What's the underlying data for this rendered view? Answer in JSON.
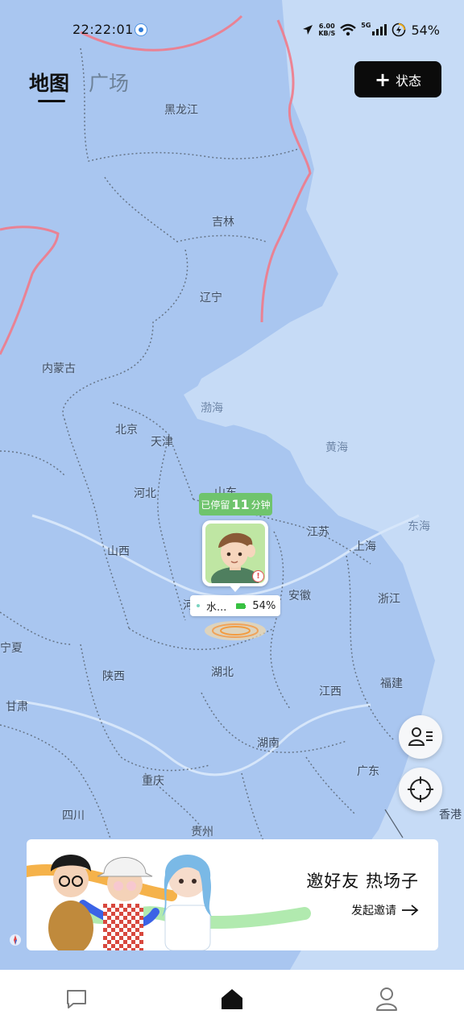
{
  "status_bar": {
    "time": "22:22:01",
    "speed_value": "6.00",
    "speed_unit": "KB/S",
    "network": "5G",
    "battery": "54%"
  },
  "tabs": {
    "map": "地图",
    "plaza": "广场"
  },
  "status_button": {
    "label": "状态",
    "icon": "plus-icon"
  },
  "map": {
    "provinces": [
      "黑龙江",
      "吉林",
      "辽宁",
      "内蒙古",
      "北京",
      "天津",
      "河北",
      "山东",
      "山西",
      "江苏",
      "上海",
      "安徽",
      "河南",
      "浙江",
      "宁夏",
      "陕西",
      "湖北",
      "江西",
      "福建",
      "甘肃",
      "湖南",
      "广东",
      "重庆",
      "四川",
      "贵州",
      "香港"
    ],
    "seas": [
      "渤海",
      "黄海",
      "东海"
    ]
  },
  "friend": {
    "stay_prefix": "已停留",
    "stay_value": "11",
    "stay_suffix": "分钟",
    "name": "水...",
    "battery": "54%"
  },
  "banner": {
    "title": "邀好友 热场子",
    "action": "发起邀请"
  },
  "nav": {
    "items": [
      "chat-icon",
      "home-icon",
      "profile-icon"
    ],
    "active": "home"
  },
  "colors": {
    "land": "#a9c6f0",
    "sea": "#c6dbf6",
    "accent_green": "#6fc46d",
    "border_red": "#f07a8a"
  }
}
